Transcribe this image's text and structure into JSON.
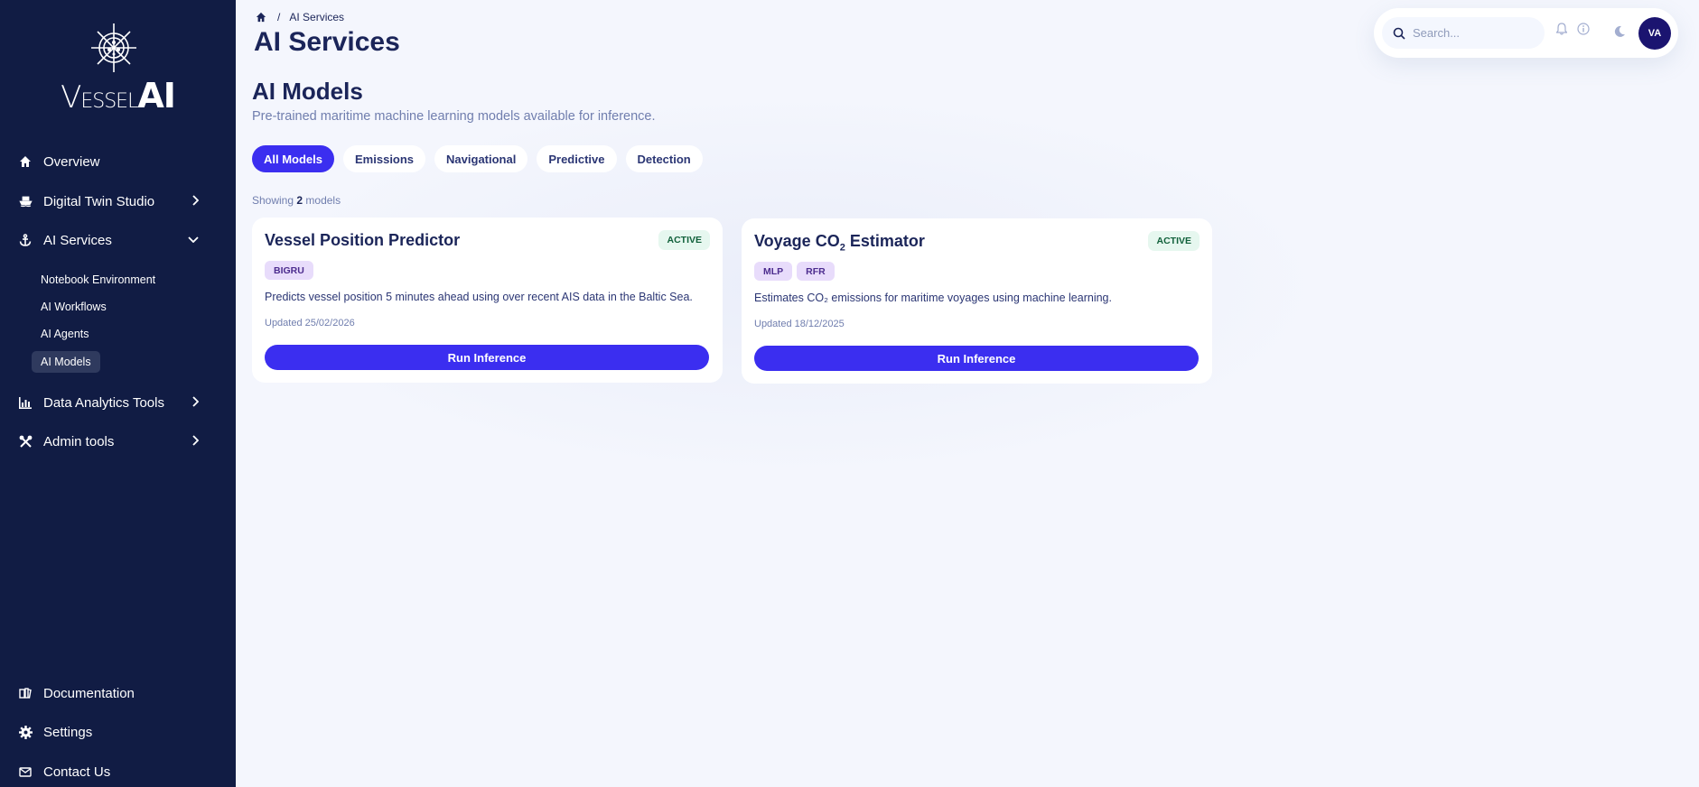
{
  "brand": {
    "name_part1": "V",
    "name_part2": "ESSEL",
    "name_part3": "AI"
  },
  "sidebar": {
    "items": [
      {
        "label": "Overview",
        "icon": "home-icon"
      },
      {
        "label": "Digital Twin Studio",
        "icon": "ship-icon"
      },
      {
        "label": "AI Services",
        "icon": "anchor-icon"
      },
      {
        "label": "Data Analytics Tools",
        "icon": "chart-icon"
      },
      {
        "label": "Admin tools",
        "icon": "tools-icon"
      }
    ],
    "ai_services_sub": [
      {
        "label": "Notebook Environment"
      },
      {
        "label": "AI Workflows"
      },
      {
        "label": "AI Agents"
      },
      {
        "label": "AI Models",
        "active": true
      }
    ],
    "bottom_items": [
      {
        "label": "Documentation",
        "icon": "book-icon"
      },
      {
        "label": "Settings",
        "icon": "gear-icon"
      },
      {
        "label": "Contact Us",
        "icon": "mail-icon"
      }
    ]
  },
  "breadcrumb": {
    "separator": "/",
    "current": "AI Services"
  },
  "header": {
    "title": "AI Services"
  },
  "topbar": {
    "search_placeholder": "Search...",
    "avatar_initials": "VA"
  },
  "main": {
    "section_title": "AI Models",
    "section_description": "Pre-trained maritime machine learning models available for inference.",
    "filters": [
      "All Models",
      "Emissions",
      "Navigational",
      "Predictive",
      "Detection"
    ],
    "active_filter": "All Models",
    "showing_prefix": "Showing",
    "showing_count": "2",
    "showing_suffix": "models"
  },
  "models": [
    {
      "title": "Vessel Position Predictor",
      "status": "ACTIVE",
      "tags": [
        "BIGRU"
      ],
      "description": "Predicts vessel position 5 minutes ahead using over recent AIS data in the Baltic Sea.",
      "updated": "Updated 25/02/2026",
      "button": "Run Inference"
    },
    {
      "title_prefix": "Voyage CO",
      "title_sub": "2",
      "title_suffix": " Estimator",
      "status": "ACTIVE",
      "tags": [
        "MLP",
        "RFR"
      ],
      "description": "Estimates CO₂ emissions for maritime voyages using machine learning.",
      "updated": "Updated 18/12/2025",
      "button": "Run Inference"
    }
  ],
  "colors": {
    "sidebar_bg": "#111c44",
    "accent": "#3b2ef0",
    "page_bg": "#f4f6fd",
    "active_badge_bg": "#e6f7ef",
    "tag_bg": "#e8dcfb"
  }
}
